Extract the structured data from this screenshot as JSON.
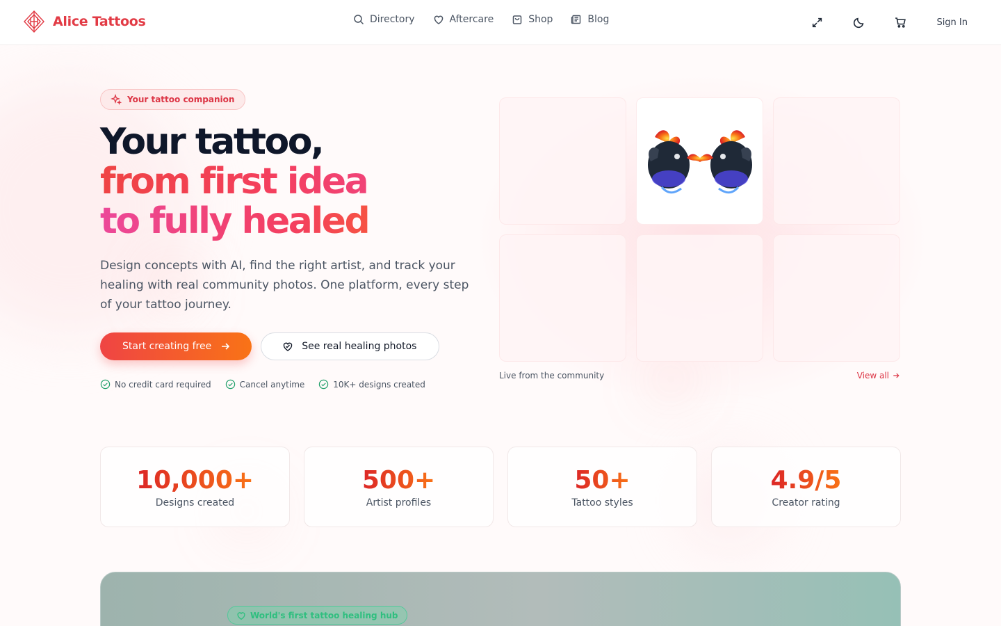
{
  "brand": {
    "name": "Alice Tattoos",
    "color": "#e23b45"
  },
  "nav": {
    "items": [
      {
        "label": "Directory",
        "icon": "search-icon"
      },
      {
        "label": "Aftercare",
        "icon": "heart-icon"
      },
      {
        "label": "Shop",
        "icon": "shopping-bag-icon"
      },
      {
        "label": "Blog",
        "icon": "newspaper-icon"
      }
    ]
  },
  "header_actions": {
    "icons": [
      "expand-icon",
      "moon-icon",
      "cart-icon"
    ],
    "signin_label": "Sign In"
  },
  "hero": {
    "badge": "Your tattoo companion",
    "headline": {
      "line1": "Your tattoo,",
      "line2": "from first idea",
      "line3": "to fully healed"
    },
    "subtitle": "Design concepts with AI, find the right artist, and track your healing with real community photos. One platform, every step of your tattoo journey.",
    "primary_cta": "Start creating free",
    "secondary_cta": "See real healing photos",
    "checks": [
      "No credit card required",
      "Cancel anytime",
      "10K+ designs created"
    ]
  },
  "community": {
    "caption": "Live from the community",
    "view_all": "View all"
  },
  "stats": [
    {
      "value": "10,000+",
      "label": "Designs created"
    },
    {
      "value": "500+",
      "label": "Artist profiles"
    },
    {
      "value": "50+",
      "label": "Tattoo styles"
    },
    {
      "value": "4.9/5",
      "label": "Creator rating"
    }
  ],
  "banner": {
    "pill": "World's first tattoo healing hub"
  },
  "colors": {
    "accent": "#ef4444",
    "accent_end": "#f97316",
    "pink": "#ec4899",
    "success": "#22a06b"
  }
}
